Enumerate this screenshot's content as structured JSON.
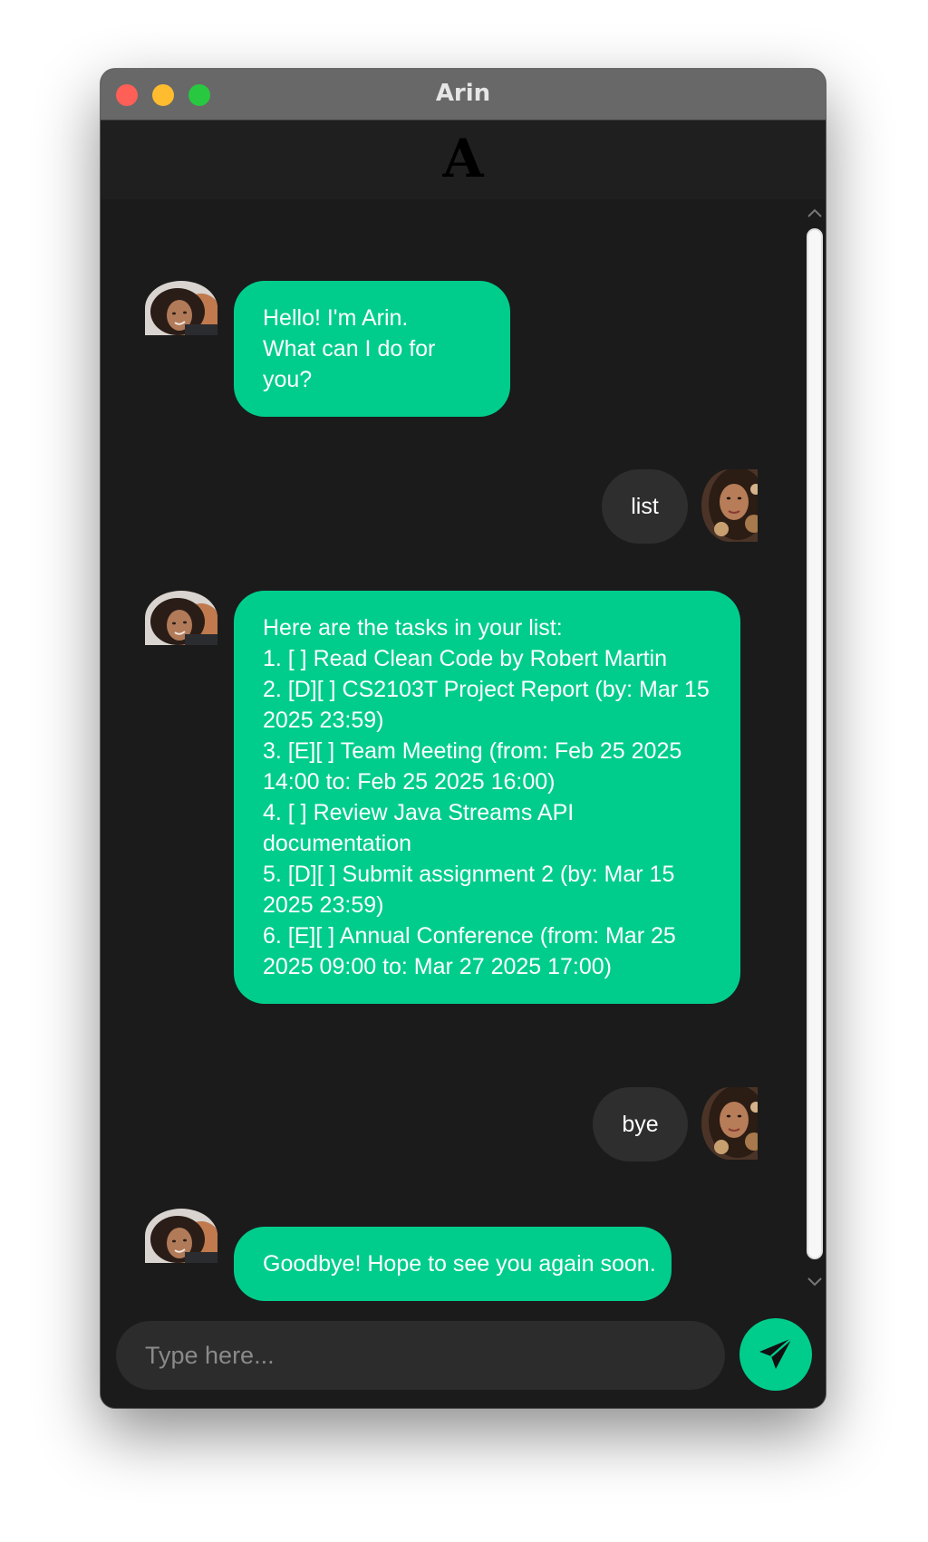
{
  "window": {
    "title": "Arin"
  },
  "header": {
    "logo": "A"
  },
  "messages": [
    {
      "sender": "bot",
      "text": "Hello! I'm Arin.\nWhat can I do for you?"
    },
    {
      "sender": "user",
      "text": "list"
    },
    {
      "sender": "bot",
      "text": "Here are the tasks in your list:\n1. [ ] Read Clean Code by Robert Martin\n2. [D][ ] CS2103T Project Report (by: Mar 15 2025 23:59)\n3. [E][ ] Team Meeting (from: Feb 25 2025 14:00 to: Feb 25 2025 16:00)\n4. [ ] Review Java Streams API documentation\n5. [D][ ] Submit assignment 2 (by: Mar 15 2025 23:59)\n6. [E][ ] Annual Conference (from: Mar 25 2025 09:00 to: Mar 27 2025 17:00)"
    },
    {
      "sender": "user",
      "text": "bye"
    },
    {
      "sender": "bot",
      "text": "Goodbye! Hope to see you again soon."
    }
  ],
  "input": {
    "placeholder": "Type here...",
    "value": ""
  },
  "icons": {
    "send": "paper-plane-icon",
    "scroll_up": "chevron-up-icon",
    "scroll_down": "chevron-down-icon"
  },
  "colors": {
    "accent": "#00cd8c",
    "background": "#1b1b1b",
    "user_bubble": "#2e2e2e",
    "titlebar": "#686868"
  }
}
